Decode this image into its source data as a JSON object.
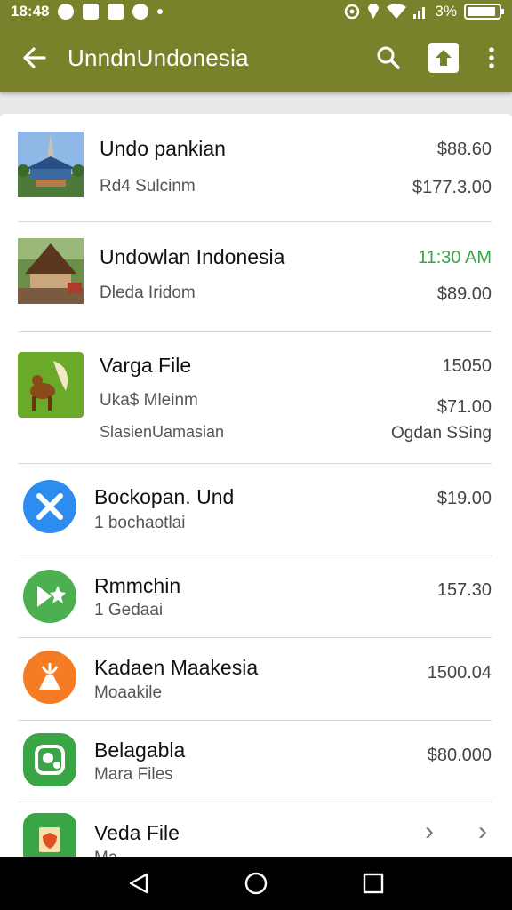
{
  "status_bar": {
    "time": "18:48",
    "battery_text": "3%",
    "battery_level": 0.9,
    "icons": [
      "notification-icon",
      "notification-icon",
      "notification-icon",
      "notification-icon",
      "notification-dot-icon",
      "nfc-icon",
      "location-icon",
      "wifi-icon",
      "signal-icon"
    ]
  },
  "app_bar": {
    "title": "UnndnUndonesia",
    "color": "#79822a",
    "icons": [
      "back-arrow-icon",
      "search-icon",
      "share-icon",
      "more-vert-icon"
    ]
  },
  "items": [
    {
      "name": "Undo pankian",
      "sub": "Rd4 Sulcinm",
      "value_top": "$88.60",
      "value_bottom": "$177.3.00",
      "thumb": "temple-photo"
    },
    {
      "name": "Undowlan Indonesia",
      "sub": "Dleda Iridom",
      "value_top": "11:30 AM",
      "value_top_color": "#3aa544",
      "value_bottom": "$89.00",
      "thumb": "house-photo"
    },
    {
      "name": "Varga File",
      "sub": "Uka$ Mleinm",
      "sub2": "SlasienUamasian",
      "value_top": "15050",
      "value_bottom": "$71.00",
      "value_third": "Ogdan SSing",
      "thumb": "deer-icon"
    },
    {
      "name": "Bockopan. Und",
      "sub": "1 bochaotlai",
      "value_top": "$19.00",
      "icon": "x-icon",
      "icon_color": "#2d8cf0"
    },
    {
      "name": "Rmmchin",
      "sub": "1 Gedaai",
      "value_top": "157.30",
      "icon": "star-x-icon",
      "icon_color": "#4caf50"
    },
    {
      "name": "Kadaen Maakesia",
      "sub": "Moaakile",
      "value_top": "1500.04",
      "icon": "person-icon",
      "icon_color": "#f57c22"
    },
    {
      "name": "Belagabla",
      "sub": "Mara Files",
      "value_top": "$80.000",
      "icon": "file-manager-icon",
      "icon_color": "#3aa544"
    },
    {
      "name": "Veda File",
      "sub": "Ma",
      "icon": "shield-file-icon",
      "icon_color": "#3aa544",
      "chevrons": [
        "›",
        "›"
      ]
    }
  ],
  "nav_bar": {
    "icons": [
      "back-nav-icon",
      "home-nav-icon",
      "recents-nav-icon"
    ]
  }
}
